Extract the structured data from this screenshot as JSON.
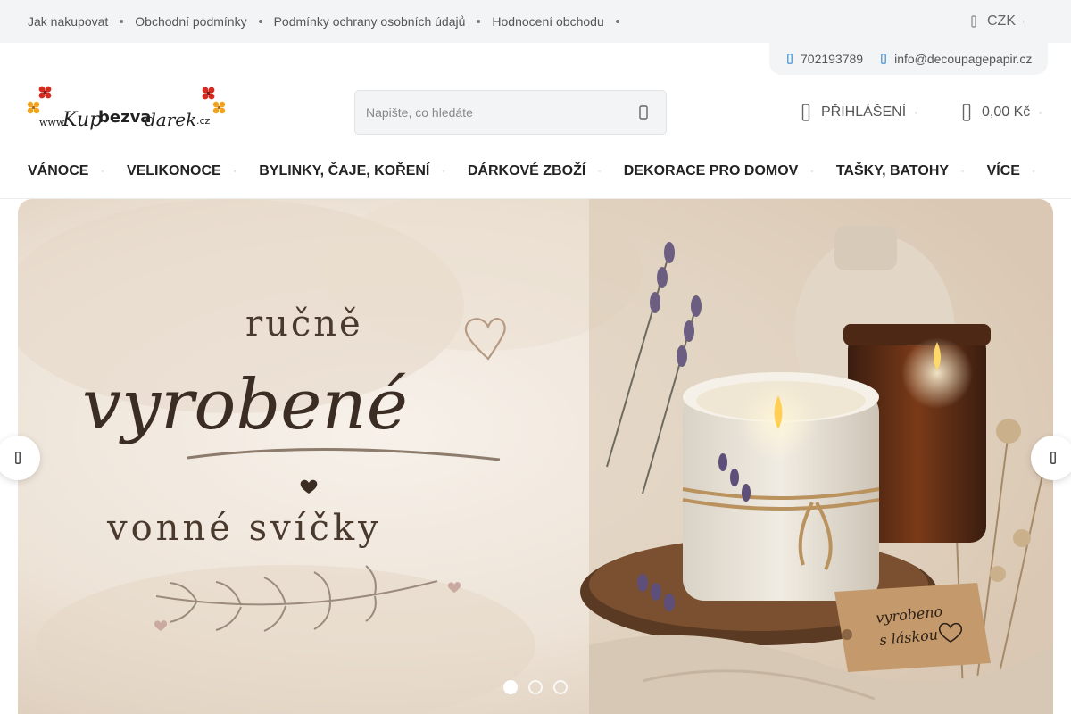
{
  "topbar": {
    "links": [
      "Jak nakupovat",
      "Obchodní podmínky",
      "Podmínky ochrany osobních údajů",
      "Hodnocení obchodu"
    ],
    "currency": "CZK"
  },
  "contact": {
    "phone": "702193789",
    "email": "info@decoupagepapir.cz"
  },
  "logo": {
    "prefix": "www.",
    "part1": "Kup",
    "part2": "bezva",
    "part3": "darek",
    "suffix": ".cz"
  },
  "search": {
    "placeholder": "Napište, co hledáte"
  },
  "account": {
    "login_label": "PŘIHLÁŠENÍ",
    "cart_total": "0,00 Kč"
  },
  "categories": [
    "VÁNOCE",
    "VELIKONOCE",
    "BYLINKY, ČAJE, KOŘENÍ",
    "DÁRKOVÉ ZBOŽÍ",
    "DEKORACE PRO DOMOV",
    "TAŠKY, BATOHY",
    "VÍCE"
  ],
  "banner": {
    "line1": "ručně",
    "line2": "vyrobené",
    "line3": "vonné svíčky",
    "tag_line1": "vyrobeno",
    "tag_line2": "s láskou",
    "slides_total": 3,
    "active_slide": 1
  },
  "colors": {
    "topbar_bg": "#f3f4f5",
    "text_dark": "#222222",
    "text_muted": "#555555",
    "banner_bg": "#ede4d9",
    "script_brown": "#4a3a2e"
  },
  "icons": [
    "currency-icon",
    "phone-icon",
    "mail-icon",
    "search-icon",
    "user-icon",
    "cart-icon",
    "chevron-down-icon",
    "arrow-left-icon",
    "arrow-right-icon"
  ]
}
